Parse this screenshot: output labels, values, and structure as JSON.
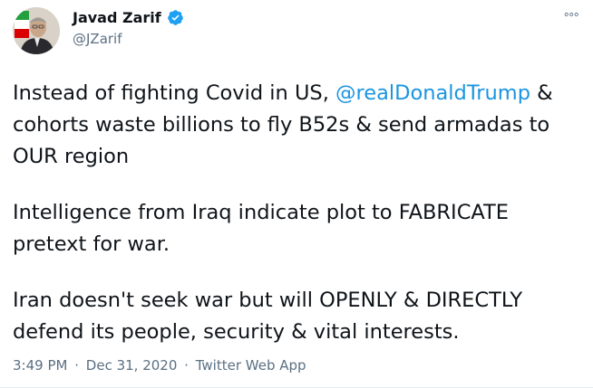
{
  "author": {
    "name": "Javad Zarif",
    "handle": "@JZarif",
    "verified": true
  },
  "more_icon": "°°°",
  "tweet": {
    "p1_before": "Instead of fighting Covid in US, ",
    "p1_mention": "@realDonaldTrump",
    "p1_after": " & cohorts waste billions to fly B52s & send armadas to OUR region",
    "p2": "Intelligence from Iraq indicate plot to FABRICATE pretext for war.",
    "p3": "Iran doesn't seek war but will OPENLY & DIRECTLY defend its people, security & vital interests."
  },
  "meta": {
    "time": "3:49 PM",
    "separator": "·",
    "date": "Dec 31, 2020",
    "source": "Twitter Web App"
  },
  "colors": {
    "link": "#1b95e0",
    "secondary_text": "#5b7083",
    "verified_badge": "#1da1f2"
  }
}
